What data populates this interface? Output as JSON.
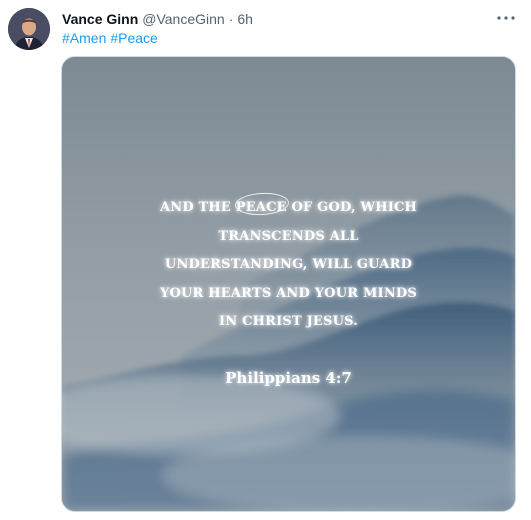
{
  "tweet": {
    "author": {
      "name": "Vance Ginn",
      "handle": "@VanceGinn",
      "separator": "·",
      "time": "6h"
    },
    "hashtags": [
      "#Amen",
      "#Peace"
    ],
    "more_icon": "more-horizontal-icon",
    "media": {
      "verse_lines": [
        "AND THE PEACE OF GOD, WHICH",
        "TRANSCENDS ALL",
        "UNDERSTANDING, WILL GUARD",
        "YOUR HEARTS AND YOUR MINDS",
        "IN CHRIST JESUS."
      ],
      "reference": "Philippians 4:7"
    }
  },
  "colors": {
    "link": "#1d9bf0",
    "name": "#0f1419",
    "secondary": "#536471",
    "border": "#cfd9de"
  }
}
